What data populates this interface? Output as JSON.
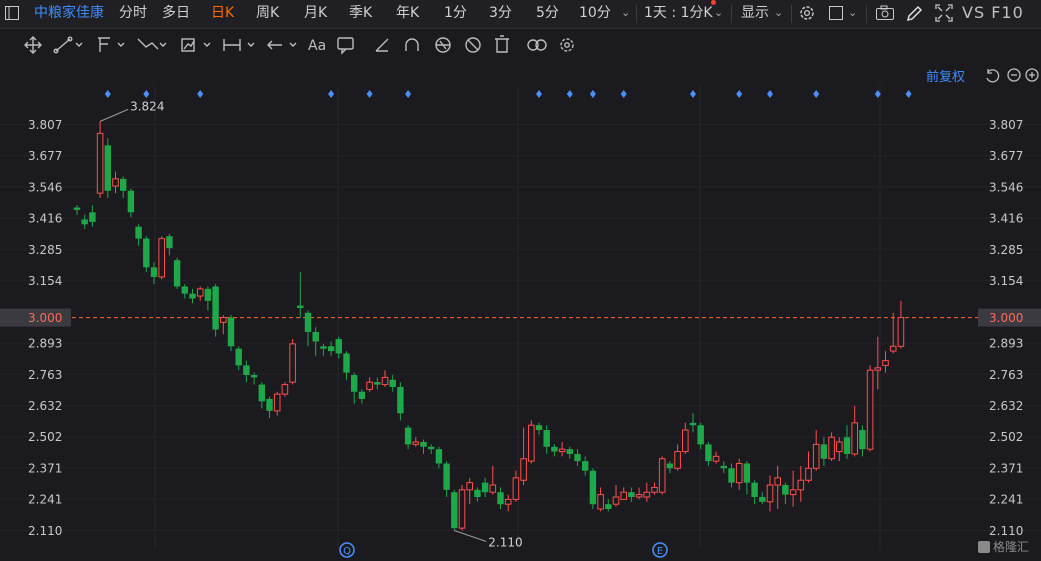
{
  "topbar": {
    "stock_name": "中粮家佳康",
    "periods": [
      "分时",
      "多日",
      "日K",
      "周K",
      "月K",
      "季K",
      "年K",
      "1分",
      "3分",
      "5分",
      "10分"
    ],
    "active_period": "日K",
    "interval": "1天 : 1分K",
    "display_label": "显示",
    "vs_label": "VS F10"
  },
  "adjust_label": "前复权",
  "watermark": "格隆汇",
  "markers": [
    "Q",
    "E"
  ],
  "colors": {
    "up": "#ff4d4d",
    "down": "#1ea84a",
    "price_line": "#ff6a2a",
    "axis_text": "#c8c8c8",
    "marker": "#4a8fff"
  },
  "chart_data": {
    "type": "candlestick",
    "current_price": 3.0,
    "y_ticks": [
      3.807,
      3.677,
      3.546,
      3.416,
      3.285,
      3.154,
      3.0,
      2.893,
      2.763,
      2.632,
      2.502,
      2.371,
      2.241,
      2.11
    ],
    "ylim": [
      2.07,
      3.86
    ],
    "high_label": "3.824",
    "low_label": "2.110",
    "dot_markers_x_index": [
      4,
      9,
      16,
      33,
      38,
      43,
      60,
      64,
      67,
      71,
      80,
      86,
      90,
      96,
      104,
      108
    ],
    "candles": [
      [
        3.46,
        3.45,
        3.47,
        3.43
      ],
      [
        3.41,
        3.39,
        3.43,
        3.37
      ],
      [
        3.44,
        3.4,
        3.47,
        3.38
      ],
      [
        3.52,
        3.77,
        3.82,
        3.5
      ],
      [
        3.72,
        3.53,
        3.75,
        3.5
      ],
      [
        3.55,
        3.58,
        3.61,
        3.52
      ],
      [
        3.58,
        3.53,
        3.59,
        3.5
      ],
      [
        3.53,
        3.44,
        3.54,
        3.42
      ],
      [
        3.38,
        3.33,
        3.39,
        3.3
      ],
      [
        3.33,
        3.21,
        3.34,
        3.19
      ],
      [
        3.21,
        3.17,
        3.23,
        3.14
      ],
      [
        3.17,
        3.33,
        3.34,
        3.16
      ],
      [
        3.34,
        3.29,
        3.35,
        3.26
      ],
      [
        3.24,
        3.13,
        3.25,
        3.12
      ],
      [
        3.13,
        3.1,
        3.14,
        3.08
      ],
      [
        3.1,
        3.08,
        3.12,
        3.06
      ],
      [
        3.09,
        3.12,
        3.13,
        3.07
      ],
      [
        3.12,
        3.07,
        3.13,
        3.03
      ],
      [
        3.13,
        2.95,
        3.14,
        2.92
      ],
      [
        2.98,
        3.0,
        3.01,
        2.93
      ],
      [
        3.0,
        2.88,
        3.01,
        2.86
      ],
      [
        2.87,
        2.8,
        2.88,
        2.78
      ],
      [
        2.8,
        2.76,
        2.82,
        2.73
      ],
      [
        2.76,
        2.75,
        2.77,
        2.72
      ],
      [
        2.72,
        2.65,
        2.73,
        2.62
      ],
      [
        2.66,
        2.61,
        2.67,
        2.58
      ],
      [
        2.61,
        2.68,
        2.69,
        2.59
      ],
      [
        2.68,
        2.72,
        2.73,
        2.67
      ],
      [
        2.73,
        2.89,
        2.91,
        2.72
      ],
      [
        3.05,
        3.04,
        3.19,
        3.0
      ],
      [
        3.02,
        2.94,
        3.03,
        2.88
      ],
      [
        2.94,
        2.9,
        2.96,
        2.84
      ],
      [
        2.88,
        2.87,
        2.89,
        2.84
      ],
      [
        2.88,
        2.86,
        2.9,
        2.84
      ],
      [
        2.91,
        2.85,
        2.92,
        2.83
      ],
      [
        2.85,
        2.77,
        2.86,
        2.74
      ],
      [
        2.76,
        2.69,
        2.77,
        2.64
      ],
      [
        2.69,
        2.66,
        2.7,
        2.64
      ],
      [
        2.7,
        2.73,
        2.75,
        2.69
      ],
      [
        2.73,
        2.72,
        2.75,
        2.7
      ],
      [
        2.72,
        2.75,
        2.78,
        2.71
      ],
      [
        2.74,
        2.71,
        2.76,
        2.69
      ],
      [
        2.71,
        2.6,
        2.73,
        2.57
      ],
      [
        2.54,
        2.47,
        2.55,
        2.45
      ],
      [
        2.47,
        2.48,
        2.5,
        2.46
      ],
      [
        2.48,
        2.46,
        2.49,
        2.43
      ],
      [
        2.46,
        2.45,
        2.47,
        2.43
      ],
      [
        2.45,
        2.39,
        2.46,
        2.37
      ],
      [
        2.39,
        2.28,
        2.4,
        2.25
      ],
      [
        2.27,
        2.12,
        2.28,
        2.11
      ],
      [
        2.12,
        2.28,
        2.3,
        2.11
      ],
      [
        2.28,
        2.31,
        2.33,
        2.22
      ],
      [
        2.28,
        2.25,
        2.29,
        2.23
      ],
      [
        2.31,
        2.27,
        2.33,
        2.25
      ],
      [
        2.27,
        2.3,
        2.38,
        2.26
      ],
      [
        2.27,
        2.22,
        2.29,
        2.2
      ],
      [
        2.22,
        2.24,
        2.26,
        2.19
      ],
      [
        2.24,
        2.33,
        2.36,
        2.23
      ],
      [
        2.32,
        2.41,
        2.54,
        2.3
      ],
      [
        2.4,
        2.55,
        2.57,
        2.39
      ],
      [
        2.55,
        2.53,
        2.56,
        2.51
      ],
      [
        2.53,
        2.46,
        2.55,
        2.43
      ],
      [
        2.46,
        2.44,
        2.47,
        2.42
      ],
      [
        2.44,
        2.45,
        2.48,
        2.42
      ],
      [
        2.45,
        2.43,
        2.46,
        2.41
      ],
      [
        2.43,
        2.4,
        2.45,
        2.38
      ],
      [
        2.4,
        2.36,
        2.42,
        2.34
      ],
      [
        2.36,
        2.22,
        2.37,
        2.2
      ],
      [
        2.2,
        2.26,
        2.29,
        2.19
      ],
      [
        2.22,
        2.2,
        2.24,
        2.19
      ],
      [
        2.22,
        2.25,
        2.3,
        2.21
      ],
      [
        2.24,
        2.27,
        2.29,
        2.24
      ],
      [
        2.27,
        2.25,
        2.29,
        2.23
      ],
      [
        2.25,
        2.26,
        2.29,
        2.24
      ],
      [
        2.25,
        2.27,
        2.31,
        2.23
      ],
      [
        2.27,
        2.29,
        2.31,
        2.26
      ],
      [
        2.27,
        2.41,
        2.42,
        2.26
      ],
      [
        2.39,
        2.37,
        2.4,
        2.35
      ],
      [
        2.37,
        2.44,
        2.47,
        2.36
      ],
      [
        2.44,
        2.53,
        2.56,
        2.43
      ],
      [
        2.56,
        2.55,
        2.6,
        2.52
      ],
      [
        2.55,
        2.47,
        2.56,
        2.45
      ],
      [
        2.47,
        2.4,
        2.48,
        2.38
      ],
      [
        2.4,
        2.42,
        2.44,
        2.39
      ],
      [
        2.38,
        2.37,
        2.4,
        2.35
      ],
      [
        2.37,
        2.31,
        2.39,
        2.29
      ],
      [
        2.31,
        2.39,
        2.41,
        2.28
      ],
      [
        2.39,
        2.31,
        2.4,
        2.26
      ],
      [
        2.31,
        2.25,
        2.32,
        2.22
      ],
      [
        2.25,
        2.23,
        2.27,
        2.22
      ],
      [
        2.23,
        2.3,
        2.34,
        2.19
      ],
      [
        2.3,
        2.33,
        2.38,
        2.2
      ],
      [
        2.3,
        2.26,
        2.31,
        2.22
      ],
      [
        2.26,
        2.28,
        2.36,
        2.21
      ],
      [
        2.28,
        2.32,
        2.38,
        2.23
      ],
      [
        2.32,
        2.37,
        2.44,
        2.31
      ],
      [
        2.37,
        2.47,
        2.53,
        2.36
      ],
      [
        2.47,
        2.41,
        2.5,
        2.38
      ],
      [
        2.41,
        2.5,
        2.52,
        2.4
      ],
      [
        2.44,
        2.48,
        2.5,
        2.4
      ],
      [
        2.5,
        2.43,
        2.55,
        2.41
      ],
      [
        2.43,
        2.56,
        2.63,
        2.42
      ],
      [
        2.53,
        2.45,
        2.55,
        2.42
      ],
      [
        2.45,
        2.78,
        2.8,
        2.44
      ],
      [
        2.78,
        2.79,
        2.92,
        2.7
      ],
      [
        2.8,
        2.82,
        2.86,
        2.77
      ],
      [
        2.86,
        2.88,
        3.02,
        2.85
      ],
      [
        2.88,
        3.0,
        3.07,
        2.87
      ]
    ]
  }
}
